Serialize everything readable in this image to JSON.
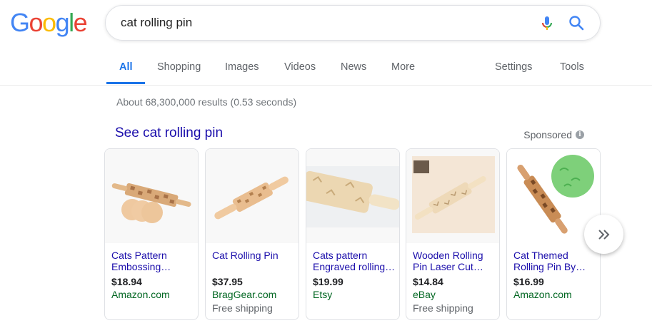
{
  "logo": {
    "letters": [
      "G",
      "o",
      "o",
      "g",
      "l",
      "e"
    ]
  },
  "search": {
    "query": "cat rolling pin"
  },
  "tabs": {
    "all": "All",
    "shopping": "Shopping",
    "images": "Images",
    "videos": "Videos",
    "news": "News",
    "more": "More",
    "settings": "Settings",
    "tools": "Tools"
  },
  "stats": "About 68,300,000 results (0.53 seconds)",
  "shopping": {
    "title": "See cat rolling pin",
    "sponsored": "Sponsored",
    "info_glyph": "i",
    "products": [
      {
        "title_line1": "Cats Pattern",
        "title_line2": "Embossing…",
        "price": "$18.94",
        "merchant": "Amazon.com",
        "shipping": ""
      },
      {
        "title_line1": "Cat Rolling Pin",
        "title_line2": "",
        "price": "$37.95",
        "merchant": "BragGear.com",
        "shipping": "Free shipping"
      },
      {
        "title_line1": "Cats pattern",
        "title_line2": "Engraved rolling…",
        "price": "$19.99",
        "merchant": "Etsy",
        "shipping": ""
      },
      {
        "title_line1": "Wooden Rolling",
        "title_line2": "Pin Laser Cut…",
        "price": "$14.84",
        "merchant": "eBay",
        "shipping": "Free shipping"
      },
      {
        "title_line1": "Cat Themed",
        "title_line2": "Rolling Pin By…",
        "price": "$16.99",
        "merchant": "Amazon.com",
        "shipping": ""
      }
    ]
  },
  "colors": {
    "link": "#1a0dab",
    "merchant": "#006621",
    "accent": "#1a73e8",
    "logo_blue": "#4285f4",
    "logo_red": "#ea4335",
    "logo_yellow": "#fbbc05",
    "logo_green": "#34a853"
  },
  "icons": {
    "mic": "mic-icon",
    "search": "search-icon",
    "info": "info-icon",
    "next": "chevron-double-right-icon"
  }
}
